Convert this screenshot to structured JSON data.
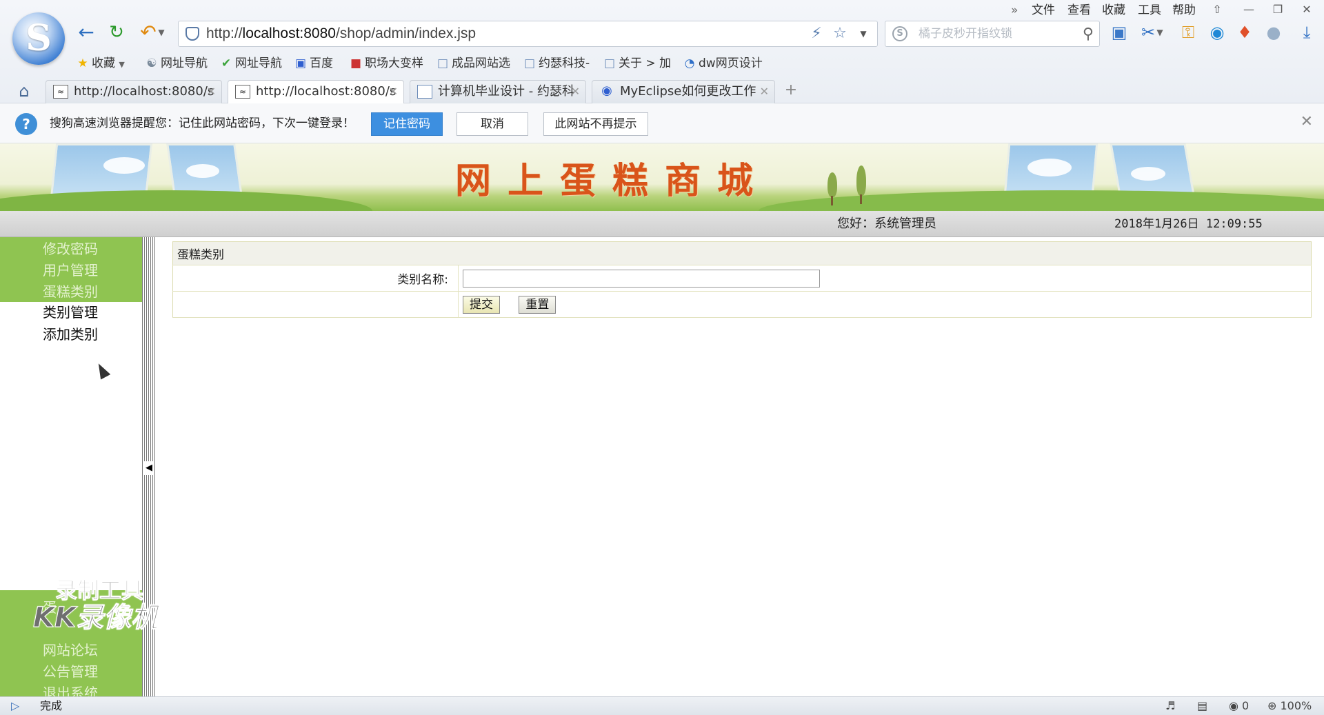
{
  "browser": {
    "menu": [
      "文件",
      "查看",
      "收藏",
      "工具",
      "帮助"
    ],
    "url_prefix": "http://",
    "url_host": "localhost:8080",
    "url_path": "/shop/admin/index.jsp",
    "search_placeholder": "橘子皮秒开指纹锁",
    "favorites": [
      {
        "icon": "star-icon",
        "label": "收藏"
      },
      {
        "icon": "globe-icon",
        "label": "网址导航"
      },
      {
        "icon": "hao-icon",
        "label": "网址导航"
      },
      {
        "icon": "baidu-icon",
        "label": "百度"
      },
      {
        "icon": "app-icon",
        "label": "职场大变样"
      },
      {
        "icon": "doc-icon",
        "label": "成品网站选"
      },
      {
        "icon": "doc-icon",
        "label": "约瑟科技-"
      },
      {
        "icon": "doc-icon",
        "label": "关于 > 加"
      },
      {
        "icon": "dw-icon",
        "label": "dw网页设计"
      }
    ],
    "tabs": [
      {
        "label": "http://localhost:8080/s",
        "active": false
      },
      {
        "label": "http://localhost:8080/s",
        "active": true
      },
      {
        "label": "计算机毕业设计 - 约瑟科",
        "active": false
      },
      {
        "label": "MyEclipse如何更改工作",
        "active": false
      }
    ]
  },
  "notice": {
    "text": "搜狗高速浏览器提醒您：记住此网站密码，下次一键登录！",
    "remember_label": "记住密码",
    "cancel_label": "取消",
    "never_label": "此网站不再提示"
  },
  "site": {
    "title": "网上蛋糕商城",
    "greeting": "您好：系统管理员",
    "datetime": "2018年1月26日 12:09:55"
  },
  "sidebar": {
    "top_items": [
      "修改密码",
      "用户管理",
      "蛋糕类别"
    ],
    "sub_items": [
      "类别管理",
      "添加类别"
    ],
    "bottom_items": [
      "网站论坛",
      "公告管理",
      "退出系统"
    ],
    "bottom_hidden_first": "蛋"
  },
  "watermark": {
    "line1": "录制工具",
    "line2": "KK录像机"
  },
  "form": {
    "section_title": "蛋糕类别",
    "field_label": "类别名称:",
    "field_value": "",
    "submit_label": "提交",
    "reset_label": "重置"
  },
  "status": {
    "text": "完成",
    "count": "0",
    "zoom": "100%"
  },
  "colors": {
    "sidebar_green": "#8fc451",
    "title_orange": "#d9541a",
    "notice_blue": "#3d8fe0"
  }
}
